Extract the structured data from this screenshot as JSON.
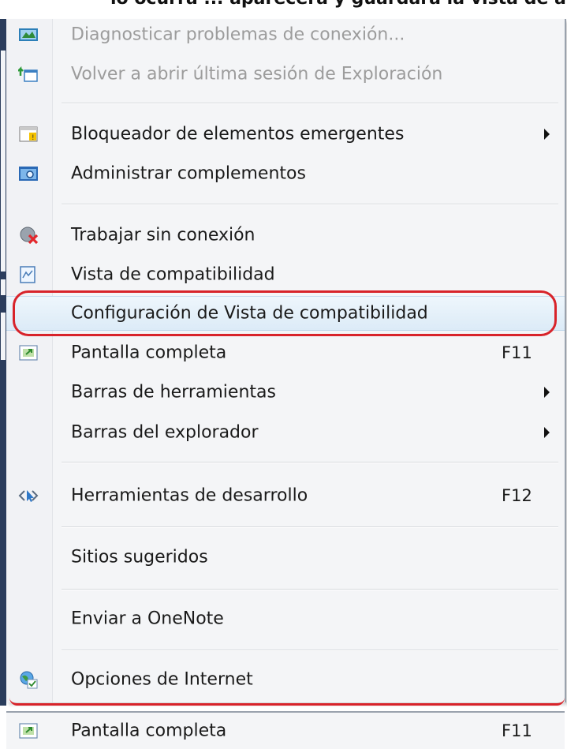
{
  "top_caption": "lo ocurra ... aparecerá y guardará la vista de ar",
  "menu": {
    "items": [
      {
        "label": "Diagnosticar problemas de conexión...",
        "icon": "diagnose-network-icon",
        "disabled": true
      },
      {
        "label": "Volver a abrir última sesión de Exploración",
        "icon": "reopen-session-icon",
        "disabled": true
      },
      {
        "label": "Bloqueador de elementos emergentes",
        "icon": "popup-blocker-icon",
        "submenu": true
      },
      {
        "label": "Administrar complementos",
        "icon": "manage-addons-icon"
      },
      {
        "label": "Trabajar sin conexión",
        "icon": "work-offline-icon"
      },
      {
        "label": "Vista de compatibilidad",
        "icon": "compatibility-view-icon"
      },
      {
        "label": "Configuración de Vista de compatibilidad",
        "highlighted": true
      },
      {
        "label": "Pantalla completa",
        "icon": "fullscreen-icon",
        "shortcut": "F11"
      },
      {
        "label": "Barras de herramientas",
        "submenu": true
      },
      {
        "label": "Barras del explorador",
        "submenu": true
      },
      {
        "label": "Herramientas de desarrollo",
        "icon": "developer-tools-icon",
        "shortcut": "F12"
      },
      {
        "label": "Sitios sugeridos"
      },
      {
        "label": "Enviar a OneNote"
      },
      {
        "label": "Opciones de Internet",
        "icon": "internet-options-icon"
      }
    ]
  },
  "bottom_item": {
    "label": "Pantalla completa",
    "shortcut": "F11",
    "icon": "fullscreen-icon"
  },
  "colors": {
    "highlight_oval": "#d8232a",
    "disabled_text": "#9c9c9c",
    "menu_bg": "#f4f5f7"
  }
}
